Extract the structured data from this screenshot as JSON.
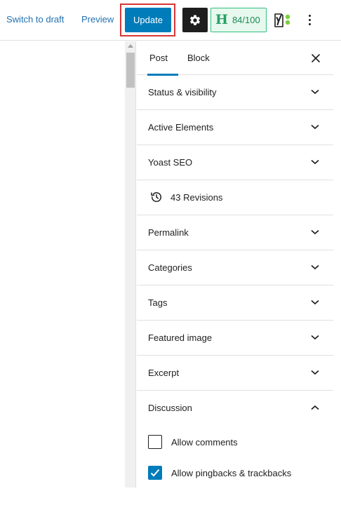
{
  "toolbar": {
    "switch_to_draft": "Switch to draft",
    "preview": "Preview",
    "update": "Update",
    "score": "84/100",
    "score_letter": "H",
    "accent_color": "#007cba",
    "highlight_color": "#d63638"
  },
  "sidebar": {
    "tabs": [
      {
        "label": "Post",
        "active": true
      },
      {
        "label": "Block",
        "active": false
      }
    ],
    "panels": [
      {
        "title": "Status & visibility",
        "expanded": false
      },
      {
        "title": "Active Elements",
        "expanded": false
      },
      {
        "title": "Yoast SEO",
        "expanded": false
      },
      {
        "title": "43 Revisions",
        "icon": "history-icon"
      },
      {
        "title": "Permalink",
        "expanded": false
      },
      {
        "title": "Categories",
        "expanded": false
      },
      {
        "title": "Tags",
        "expanded": false
      },
      {
        "title": "Featured image",
        "expanded": false
      },
      {
        "title": "Excerpt",
        "expanded": false
      },
      {
        "title": "Discussion",
        "expanded": true
      }
    ],
    "discussion": {
      "options": [
        {
          "label": "Allow comments",
          "checked": false
        },
        {
          "label": "Allow pingbacks & trackbacks",
          "checked": true
        }
      ]
    }
  }
}
